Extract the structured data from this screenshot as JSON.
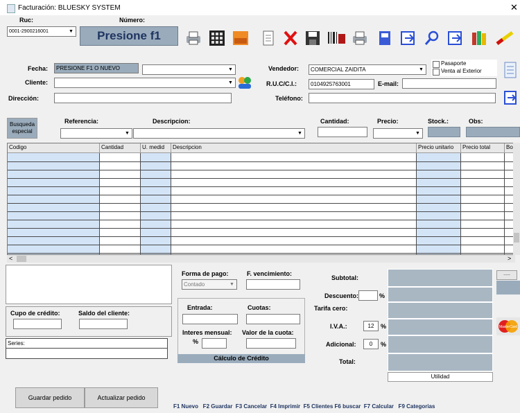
{
  "window": {
    "title": "Facturación: BLUESKY SYSTEM",
    "close": "✕"
  },
  "header": {
    "ruc_label": "Ruc:",
    "ruc_value": "0001-2900216001",
    "numero_label": "Número:",
    "numero_button": "Presione f1"
  },
  "form": {
    "fecha_label": "Fecha:",
    "fecha_value": "PRESIONE F1 O NUEVO",
    "cliente_label": "Cliente:",
    "direccion_label": "Dirección:",
    "vendedor_label": "Vendedor:",
    "vendedor_value": "COMERCIAL ZAIDITA",
    "ruc_ci_label": "R.U.C/C.I.:",
    "ruc_ci_value": "0104925763001",
    "email_label": "E-mail:",
    "telefono_label": "Teléfono:",
    "pasaporte_label": "Pasaporte",
    "venta_exterior_label": "Venta al Exterior"
  },
  "item_entry": {
    "busqueda_label": "Busqueda especial",
    "referencia_label": "Referencia:",
    "descripcion_label": "Descripcion:",
    "cantidad_label": "Cantidad:",
    "precio_label": "Precio:",
    "stock_label": "Stock.:",
    "obs_label": "Obs:"
  },
  "grid": {
    "columns": [
      "Codigo",
      "Cantidad",
      "U. medid",
      "Descripcion",
      "Precio unitario",
      "Precio total",
      "Bo"
    ]
  },
  "payment": {
    "forma_pago_label": "Forma de pago:",
    "forma_pago_value": "Contado",
    "vencimiento_label": "F. vencimiento:",
    "entrada_label": "Entrada:",
    "cuotas_label": "Cuotas:",
    "interes_label": "Interes mensual:",
    "percent_sign": "%",
    "valor_cuota_label": "Valor de la cuota:",
    "calculo_button": "Cálculo de Crédito"
  },
  "credit": {
    "cupo_label": "Cupo de crédito:",
    "saldo_label": "Saldo del cliente:",
    "series_label": "Series:"
  },
  "totals": {
    "subtotal_label": "Subtotal:",
    "descuento_label": "Descuento:",
    "tarifa_cero_label": "Tarifa cero:",
    "iva_label": "I.V.A.:",
    "iva_value": "12",
    "adicional_label": "Adicional:",
    "adicional_value": "0",
    "total_label": "Total:",
    "utilidad_label": "Utilidad",
    "percent": "%"
  },
  "buttons": {
    "guardar_pedido": "Guardar pedido",
    "actualizar_pedido": "Actualizar pedido",
    "side_small": "....."
  },
  "shortcuts": "F1 Nuevo   F2 Guardar  F3 Cancelar  F4 Imprimir  F5 Clientes F6 buscar  F7 Calcular   F9 Categorias",
  "scroll": {
    "left": "<",
    "right": ">"
  },
  "card_brand": "MasterCard"
}
